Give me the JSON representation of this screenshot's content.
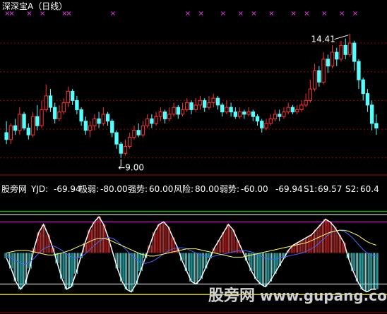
{
  "title": "深深宝A（日线）",
  "title_letter": "A",
  "title_period": "(日线)",
  "title_main": "深深宝",
  "upper_panel": {
    "high_label": "14.41",
    "low_label": "9.00",
    "y_range": [
      8.5,
      15.2
    ],
    "gridlines": [
      14.0,
      12.75,
      11.5,
      10.25,
      9.0
    ]
  },
  "indicator": {
    "name": "股旁网",
    "yjd_label": "YJD:",
    "yjd_value": "-69.94",
    "jiruo_label": "极弱:",
    "jiruo_value": "-80.00",
    "qiangshi_label": "强势:",
    "qiangshi_value": "60.00",
    "fengxian_label": "风险:",
    "fengxian_value": "80.00",
    "ruoshi_label": "弱势:",
    "ruoshi_value": "-60.00",
    "extra_value": "-69.94",
    "s1_label": "S1:",
    "s1_value": "69.57",
    "s2_label": "S2:",
    "s2_value": "60.4",
    "colors": {
      "yjd": "#ffffff",
      "jiruo": "#ffff00",
      "qiangshi": "#ff00ff",
      "fengxian": "#00ff00",
      "ruoshi": "#ffffff",
      "s1": "#00ffff",
      "s2": "#ffffff"
    }
  },
  "watermark": {
    "text1": "股旁网",
    "text2": "www.gupang.com"
  },
  "chart_data": {
    "type": "candlestick",
    "candles": [
      [
        10.1,
        9.8,
        10.6,
        9.6
      ],
      [
        9.8,
        10.4,
        10.5,
        9.6
      ],
      [
        10.4,
        10.2,
        10.7,
        10.0
      ],
      [
        10.2,
        10.9,
        11.2,
        10.0
      ],
      [
        10.9,
        10.3,
        11.0,
        10.2
      ],
      [
        10.3,
        10.0,
        10.5,
        9.8
      ],
      [
        10.0,
        10.8,
        11.0,
        9.9
      ],
      [
        10.8,
        10.4,
        11.3,
        10.2
      ],
      [
        10.4,
        11.1,
        11.5,
        10.3
      ],
      [
        11.1,
        11.7,
        12.2,
        11.0
      ],
      [
        11.7,
        11.2,
        12.0,
        11.0
      ],
      [
        11.2,
        10.7,
        11.4,
        10.5
      ],
      [
        10.7,
        11.0,
        11.3,
        10.6
      ],
      [
        11.0,
        11.4,
        11.6,
        10.9
      ],
      [
        11.4,
        11.9,
        12.1,
        11.2
      ],
      [
        11.9,
        11.5,
        12.0,
        11.3
      ],
      [
        11.5,
        11.1,
        11.7,
        10.9
      ],
      [
        11.1,
        10.6,
        11.2,
        10.4
      ],
      [
        10.6,
        10.2,
        10.8,
        10.0
      ],
      [
        10.2,
        10.4,
        10.6,
        9.9
      ],
      [
        10.4,
        10.7,
        10.9,
        10.2
      ],
      [
        10.7,
        10.5,
        11.0,
        10.3
      ],
      [
        10.5,
        10.9,
        11.2,
        10.4
      ],
      [
        10.9,
        10.6,
        11.0,
        10.4
      ],
      [
        10.6,
        10.1,
        10.7,
        9.9
      ],
      [
        10.1,
        9.6,
        10.2,
        9.4
      ],
      [
        9.6,
        9.2,
        9.7,
        9.0
      ],
      [
        9.2,
        9.5,
        9.8,
        9.1
      ],
      [
        9.5,
        9.9,
        10.1,
        9.4
      ],
      [
        9.9,
        10.2,
        10.4,
        9.8
      ],
      [
        10.2,
        10.0,
        10.5,
        9.9
      ],
      [
        10.0,
        10.4,
        10.6,
        9.9
      ],
      [
        10.4,
        10.7,
        10.9,
        10.3
      ],
      [
        10.7,
        10.5,
        10.9,
        10.3
      ],
      [
        10.5,
        10.8,
        11.0,
        10.4
      ],
      [
        10.8,
        11.0,
        11.2,
        10.6
      ],
      [
        11.0,
        10.7,
        11.1,
        10.5
      ],
      [
        10.7,
        10.9,
        11.2,
        10.6
      ],
      [
        10.9,
        11.2,
        11.4,
        10.8
      ],
      [
        11.2,
        10.9,
        11.3,
        10.7
      ],
      [
        10.9,
        11.1,
        11.4,
        10.8
      ],
      [
        11.1,
        11.4,
        11.6,
        11.0
      ],
      [
        11.4,
        11.1,
        11.5,
        10.9
      ],
      [
        11.1,
        11.3,
        11.6,
        11.0
      ],
      [
        11.3,
        11.5,
        11.7,
        11.1
      ],
      [
        11.5,
        11.2,
        11.6,
        11.0
      ],
      [
        11.2,
        11.4,
        11.7,
        11.1
      ],
      [
        11.4,
        11.6,
        11.8,
        11.2
      ],
      [
        11.6,
        11.3,
        11.7,
        11.1
      ],
      [
        11.3,
        11.0,
        11.4,
        10.8
      ],
      [
        11.0,
        11.2,
        11.5,
        10.9
      ],
      [
        11.2,
        11.0,
        11.4,
        10.8
      ],
      [
        11.0,
        10.8,
        11.2,
        10.7
      ],
      [
        10.8,
        11.0,
        11.2,
        10.7
      ],
      [
        11.0,
        10.9,
        11.1,
        10.7
      ],
      [
        10.9,
        11.0,
        11.2,
        10.8
      ],
      [
        11.0,
        10.8,
        11.1,
        10.6
      ],
      [
        10.8,
        10.6,
        10.9,
        10.4
      ],
      [
        10.6,
        10.3,
        10.7,
        10.1
      ],
      [
        10.3,
        10.5,
        10.7,
        10.2
      ],
      [
        10.5,
        10.7,
        10.9,
        10.4
      ],
      [
        10.7,
        10.9,
        11.1,
        10.6
      ],
      [
        10.9,
        10.8,
        11.1,
        10.6
      ],
      [
        10.8,
        11.0,
        11.2,
        10.7
      ],
      [
        11.0,
        11.2,
        11.4,
        10.9
      ],
      [
        11.2,
        11.0,
        11.3,
        10.9
      ],
      [
        11.0,
        11.1,
        11.3,
        10.9
      ],
      [
        11.1,
        11.3,
        11.5,
        11.0
      ],
      [
        11.3,
        11.5,
        11.8,
        11.2
      ],
      [
        11.5,
        12.0,
        12.4,
        11.4
      ],
      [
        12.0,
        12.8,
        13.1,
        11.9
      ],
      [
        12.8,
        12.3,
        13.0,
        12.1
      ],
      [
        12.3,
        13.3,
        13.6,
        12.2
      ],
      [
        13.3,
        13.0,
        13.5,
        12.7
      ],
      [
        13.0,
        13.6,
        13.9,
        12.9
      ],
      [
        13.6,
        13.3,
        13.8,
        13.0
      ],
      [
        13.3,
        13.9,
        14.1,
        13.2
      ],
      [
        13.9,
        13.5,
        14.2,
        13.3
      ],
      [
        13.5,
        14.0,
        14.41,
        13.4
      ],
      [
        14.0,
        13.2,
        14.1,
        12.8
      ],
      [
        13.2,
        12.4,
        13.3,
        12.0
      ],
      [
        12.4,
        11.8,
        12.5,
        11.5
      ],
      [
        11.8,
        11.3,
        12.0,
        11.0
      ],
      [
        11.3,
        10.5,
        11.5,
        10.2
      ],
      [
        10.5,
        10.3,
        10.9,
        10.0
      ]
    ],
    "indicator_series": {
      "YJD": [
        -10,
        -30,
        -55,
        -70,
        -60,
        -30,
        10,
        40,
        55,
        35,
        10,
        -20,
        -50,
        -70,
        -65,
        -40,
        -10,
        20,
        45,
        60,
        70,
        55,
        30,
        0,
        -30,
        -55,
        -70,
        -75,
        -60,
        -35,
        -10,
        15,
        40,
        55,
        60,
        50,
        30,
        10,
        -15,
        -35,
        -55,
        -60,
        -50,
        -30,
        -10,
        10,
        25,
        40,
        55,
        45,
        25,
        5,
        -15,
        -35,
        -50,
        -60,
        -65,
        -55,
        -40,
        -25,
        -10,
        5,
        15,
        20,
        25,
        30,
        35,
        45,
        55,
        65,
        60,
        50,
        35,
        20,
        -10,
        -35,
        -55,
        -70,
        -75,
        -70,
        -69.94
      ],
      "S1": [
        -5,
        -10,
        -15,
        -20,
        -22,
        -18,
        -10,
        0,
        8,
        12,
        14,
        10,
        5,
        -2,
        -8,
        -10,
        -8,
        -2,
        6,
        15,
        22,
        28,
        30,
        28,
        22,
        14,
        5,
        -4,
        -12,
        -18,
        -20,
        -18,
        -14,
        -8,
        -2,
        4,
        8,
        10,
        10,
        8,
        4,
        0,
        -4,
        -6,
        -8,
        -6,
        -4,
        -2,
        0,
        2,
        4,
        5,
        4,
        2,
        -2,
        -6,
        -10,
        -12,
        -12,
        -10,
        -8,
        -6,
        -4,
        -2,
        0,
        4,
        8,
        14,
        22,
        30,
        38,
        42,
        44,
        42,
        36,
        28,
        18,
        8,
        0,
        -4,
        -6
      ],
      "S2": [
        0,
        2,
        4,
        5,
        5,
        4,
        2,
        0,
        -2,
        -4,
        -4,
        -2,
        0,
        3,
        6,
        10,
        14,
        18,
        22,
        26,
        28,
        28,
        26,
        22,
        18,
        14,
        10,
        6,
        2,
        -2,
        -4,
        -6,
        -6,
        -4,
        -2,
        0,
        2,
        4,
        6,
        8,
        8,
        8,
        6,
        4,
        2,
        0,
        -2,
        -4,
        -6,
        -8,
        -8,
        -8,
        -6,
        -4,
        -2,
        0,
        2,
        4,
        6,
        8,
        10,
        12,
        14,
        16,
        18,
        20,
        24,
        28,
        32,
        36,
        40,
        42,
        44,
        44,
        42,
        38,
        34,
        28,
        22,
        18,
        15
      ]
    },
    "indicator_range": [
      -100,
      100
    ],
    "indicator_levels": [
      80,
      60,
      -60,
      -80
    ]
  }
}
